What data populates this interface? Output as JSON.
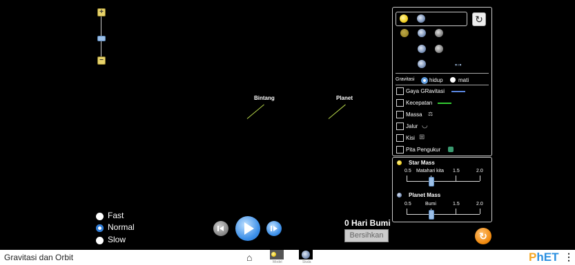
{
  "bodies": {
    "star_label": "Bintang",
    "planet_label": "Planet"
  },
  "panel": {
    "gravity_label": "Gravitasi",
    "gravity_on": "hidup",
    "gravity_off": "mati",
    "checkboxes": [
      {
        "label": "Gaya GRavitasi",
        "icon": "gravity-force-arrow-icon"
      },
      {
        "label": "Kecepatan",
        "icon": "velocity-arrow-icon"
      },
      {
        "label": "Massa",
        "icon": "scale-icon"
      },
      {
        "label": "Jalur",
        "icon": "path-icon"
      },
      {
        "label": "Kisi",
        "icon": "grid-icon"
      },
      {
        "label": "Pita Pengukur",
        "icon": "tape-measure-icon"
      }
    ]
  },
  "mass": {
    "star": {
      "title": "Star Mass",
      "ticks": [
        "0.5",
        "Matahari kita",
        "1.5",
        "2.0"
      ],
      "value": 1.0
    },
    "planet": {
      "title": "Planet Mass",
      "ticks": [
        "0.5",
        "Bumi",
        "1.5",
        "2.0"
      ],
      "value": 1.0
    }
  },
  "speed": {
    "options": [
      "Fast",
      "Normal",
      "Slow"
    ],
    "selected": "Normal"
  },
  "time": {
    "label": "0 Hari Bumi",
    "clear_button": "Bersihkan"
  },
  "navbar": {
    "title": "Gravitasi dan Orbit",
    "screens": [
      "Model",
      "Skala"
    ],
    "brand": "PhET"
  },
  "colors": {
    "accent_blue": "#2a7ad8",
    "reset_orange": "#f08a10",
    "velocity_green": "#33cc33",
    "gravity_blue": "#5a86e0"
  }
}
